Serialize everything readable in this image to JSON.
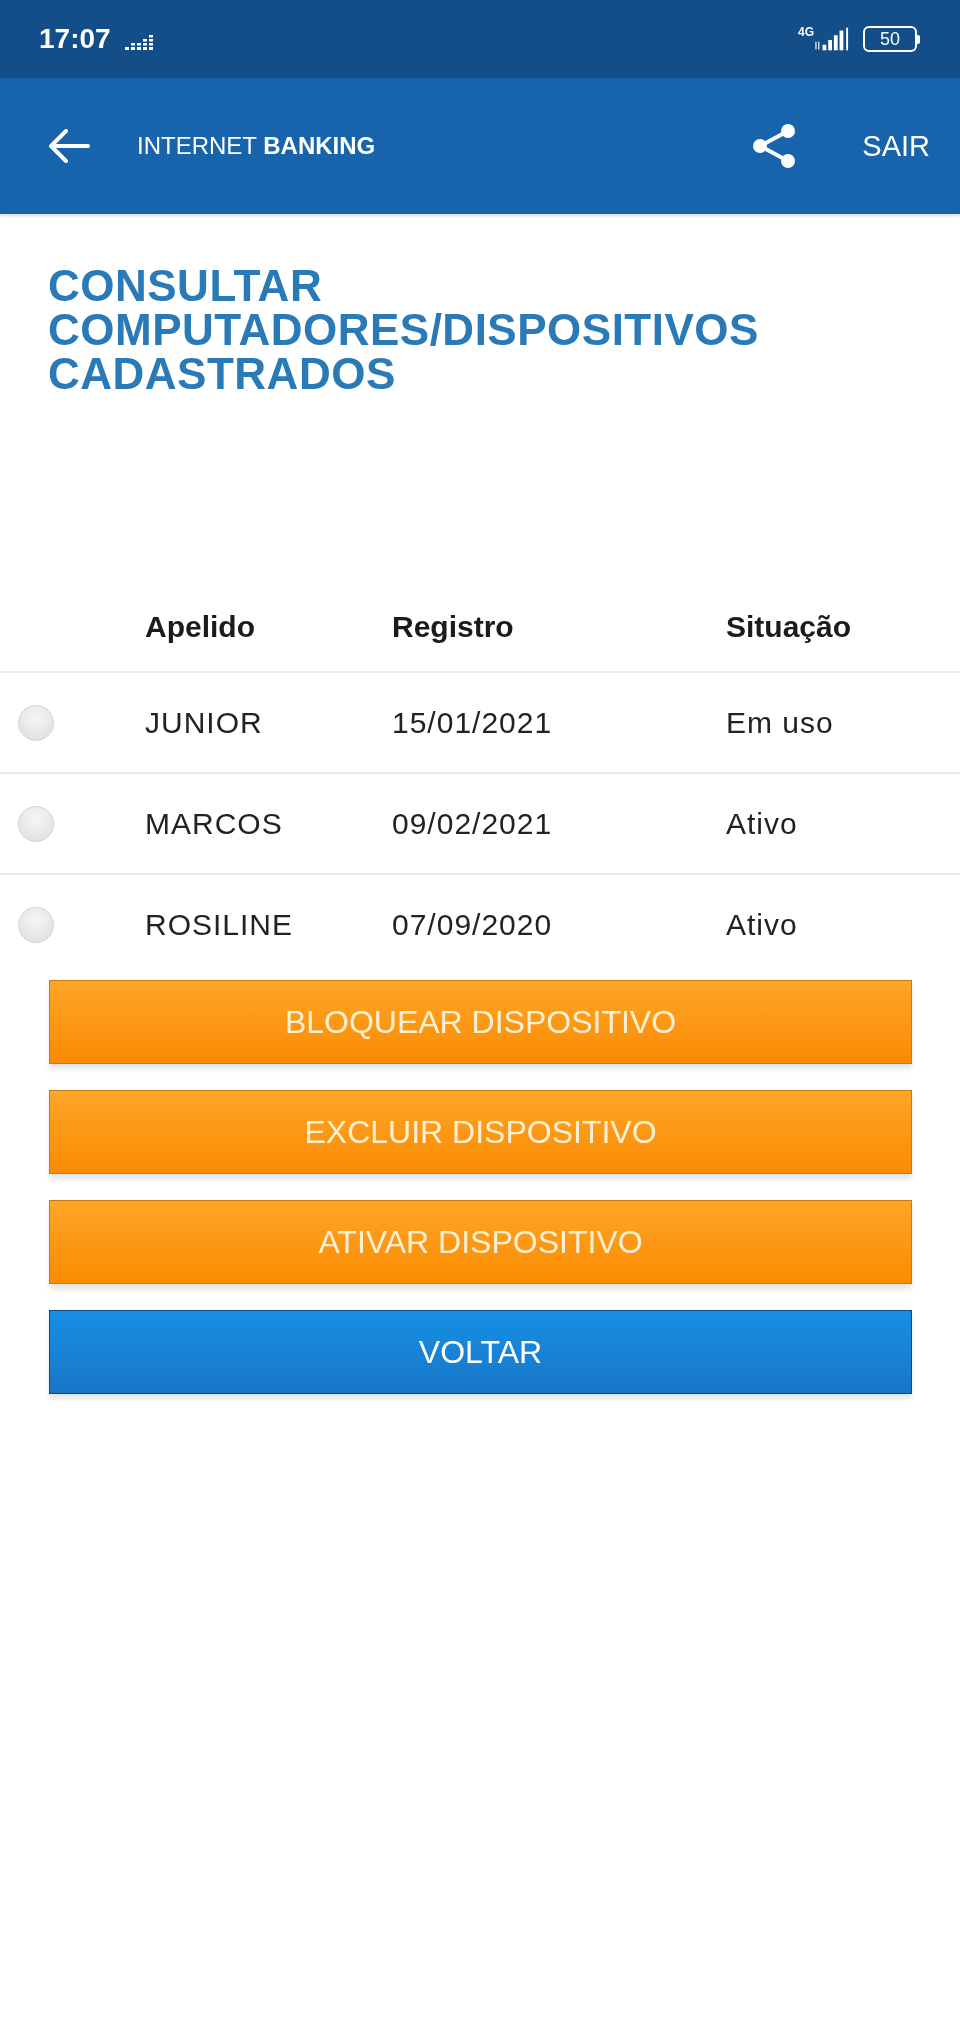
{
  "status_bar": {
    "time": "17:07",
    "network": "4G",
    "battery": "50"
  },
  "header": {
    "title": "INTERNET **BANKING**",
    "logout": "SAIR"
  },
  "page_title": "CONSULTAR COMPUTADORES/DISPOSITIVOS CADASTRADOS",
  "table": {
    "columns": [
      "Apelido",
      "Registro",
      "Situação"
    ],
    "rows": [
      {
        "selected": false,
        "cells": [
          "JUNIOR",
          "15/01/2021",
          "Em uso"
        ]
      },
      {
        "selected": false,
        "cells": [
          "MARCOS",
          "09/02/2021",
          "Ativo"
        ]
      },
      {
        "selected": false,
        "cells": [
          "ROSILINE",
          "07/09/2020",
          "Ativo"
        ]
      }
    ]
  },
  "buttons": [
    {
      "label": "BLOQUEAR DISPOSITIVO",
      "kind": "action"
    },
    {
      "label": "EXCLUIR DISPOSITIVO",
      "kind": "action"
    },
    {
      "label": "ATIVAR DISPOSITIVO",
      "kind": "action"
    },
    {
      "label": "VOLTAR",
      "kind": "back"
    }
  ]
}
